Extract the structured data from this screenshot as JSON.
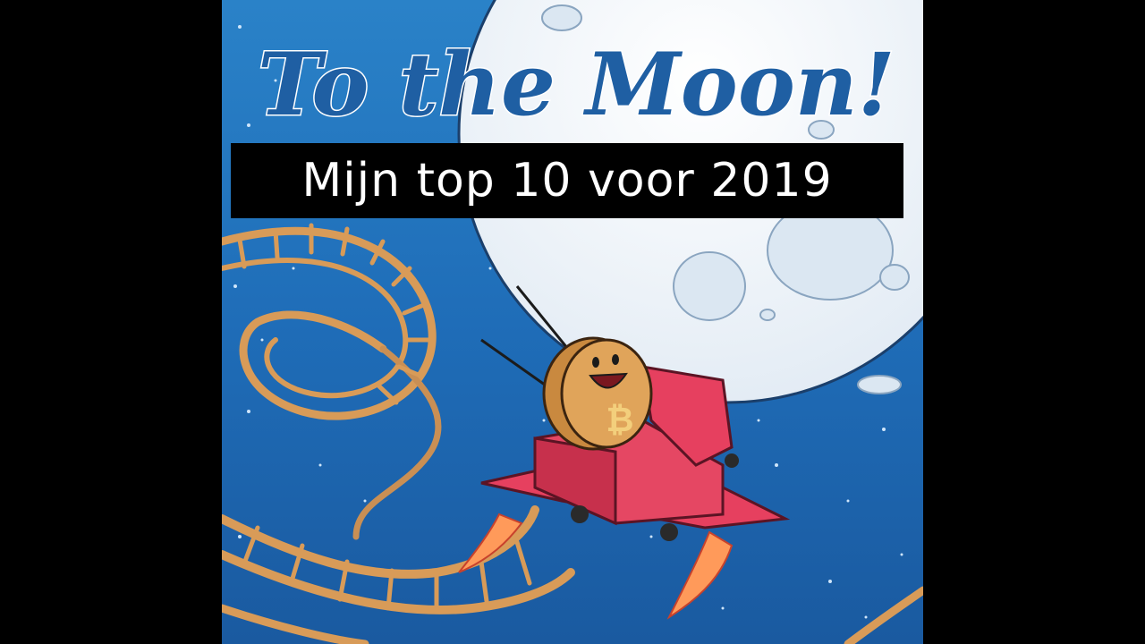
{
  "thumbnail": {
    "caption": "Mijn top 10 voor 2019",
    "art_title": "To the Moon!",
    "coin_symbol": "₿"
  },
  "colors": {
    "letterbox": "#000000",
    "sky_top": "#1d6fb8",
    "sky_bottom": "#1c5ea6",
    "moon": "#f1f5fa",
    "title_text": "#1f5fa3",
    "rocket": "#e6405f",
    "coin": "#d79a4a",
    "track": "#d79a56",
    "caption_bg": "#000000",
    "caption_text": "#ffffff"
  },
  "icons": {
    "coin": "bitcoin-coin-character",
    "vehicle": "rocket-cart",
    "track": "roller-coaster-track"
  }
}
